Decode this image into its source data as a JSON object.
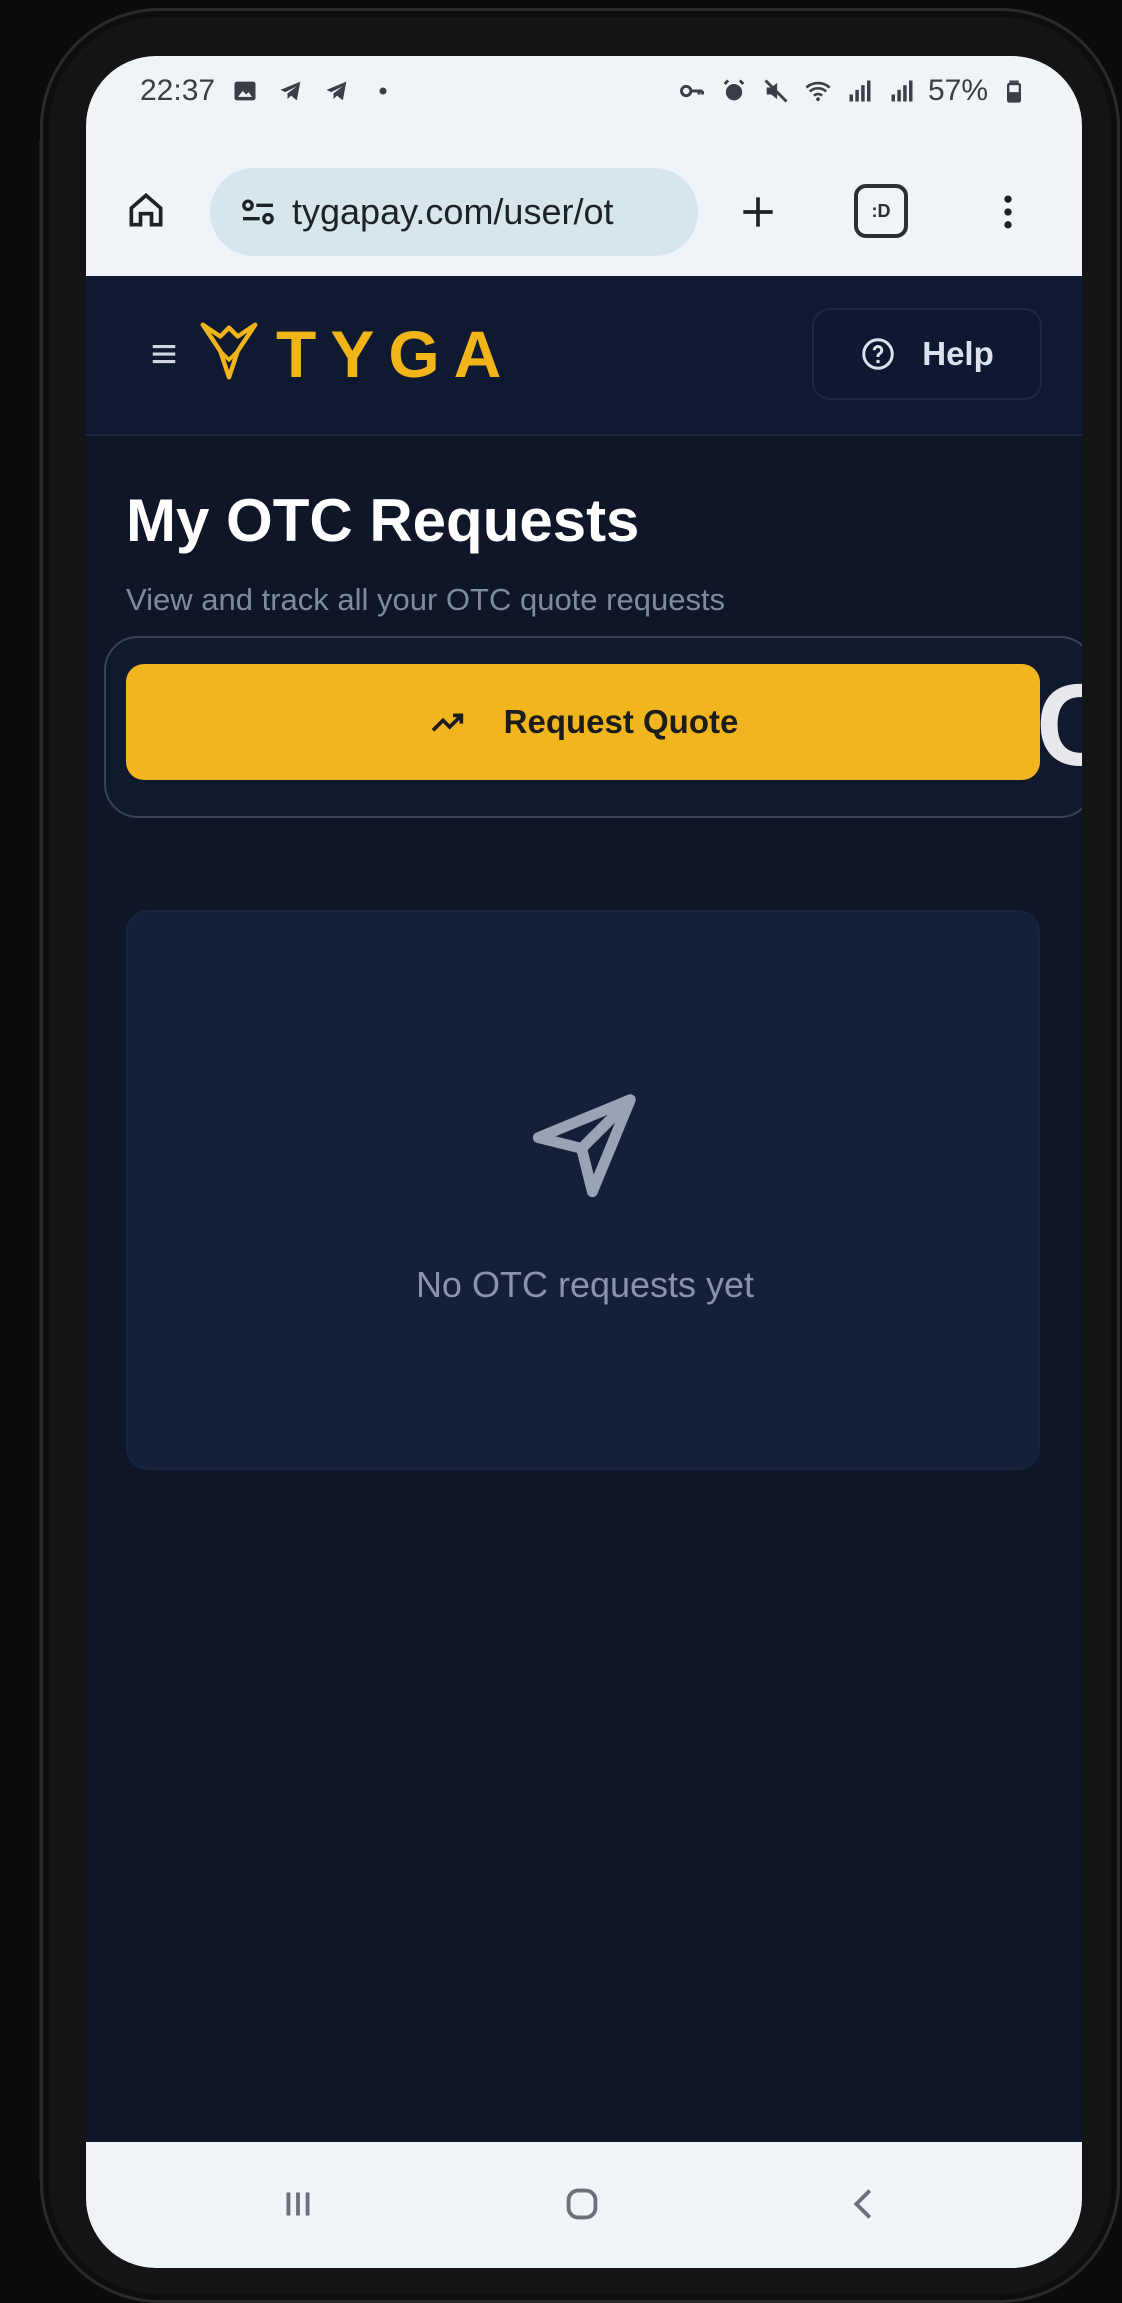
{
  "status_bar": {
    "time": "22:37",
    "battery": "57%",
    "icons_left": [
      "gallery-icon",
      "telegram-icon",
      "telegram-icon",
      "dot-icon"
    ],
    "icons_right": [
      "key-icon",
      "alarm-icon",
      "mute-icon",
      "wifi-icon",
      "signal-icon",
      "signal-icon",
      "battery-icon"
    ]
  },
  "browser": {
    "url": "tygapay.com/user/ot",
    "tabs_label": ":D"
  },
  "header": {
    "logo_text": "TYGA",
    "help_label": "Help"
  },
  "main": {
    "title": "My OTC Requests",
    "subtitle": "View and track all your OTC quote requests",
    "request_button_label": "Request Quote",
    "offscreen_glyph": "C",
    "empty_text": "No OTC requests yet"
  },
  "colors": {
    "accent": "#f1b61f",
    "background": "#0e1628",
    "header": "#0f1a30",
    "card": "#141f38",
    "muted_text": "#7f8aa1"
  }
}
